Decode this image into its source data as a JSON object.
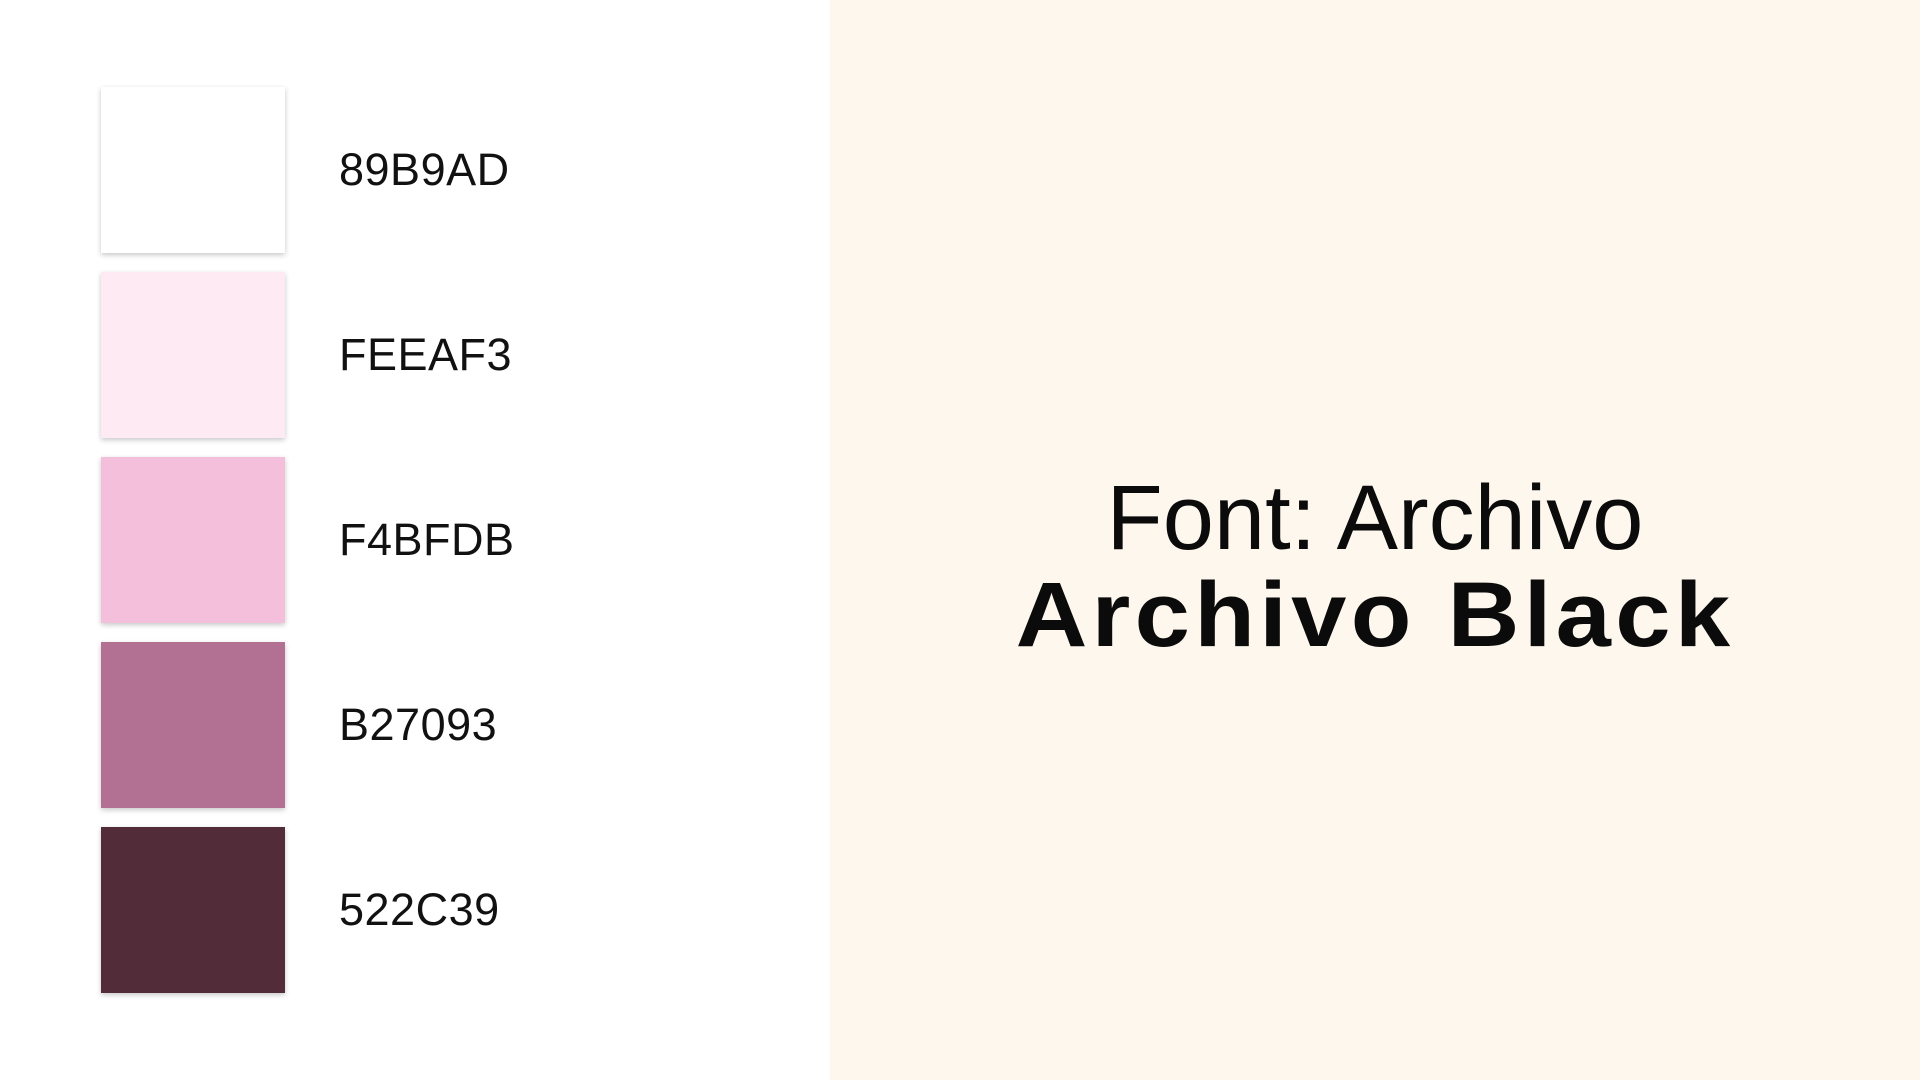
{
  "palette": {
    "swatches": [
      {
        "label": "89B9AD",
        "color": "#ffffff"
      },
      {
        "label": "FEEAF3",
        "color": "#fdeaf3"
      },
      {
        "label": "F4BFDB",
        "color": "#f3bfdb"
      },
      {
        "label": "B27093",
        "color": "#b27093"
      },
      {
        "label": "522C39",
        "color": "#522c39"
      }
    ]
  },
  "font": {
    "line1": "Font: Archivo",
    "line2": "Archivo Black"
  },
  "colors": {
    "right_panel_background": "#fdf7ed",
    "left_panel_background": "#ffffff",
    "text": "#111111"
  }
}
